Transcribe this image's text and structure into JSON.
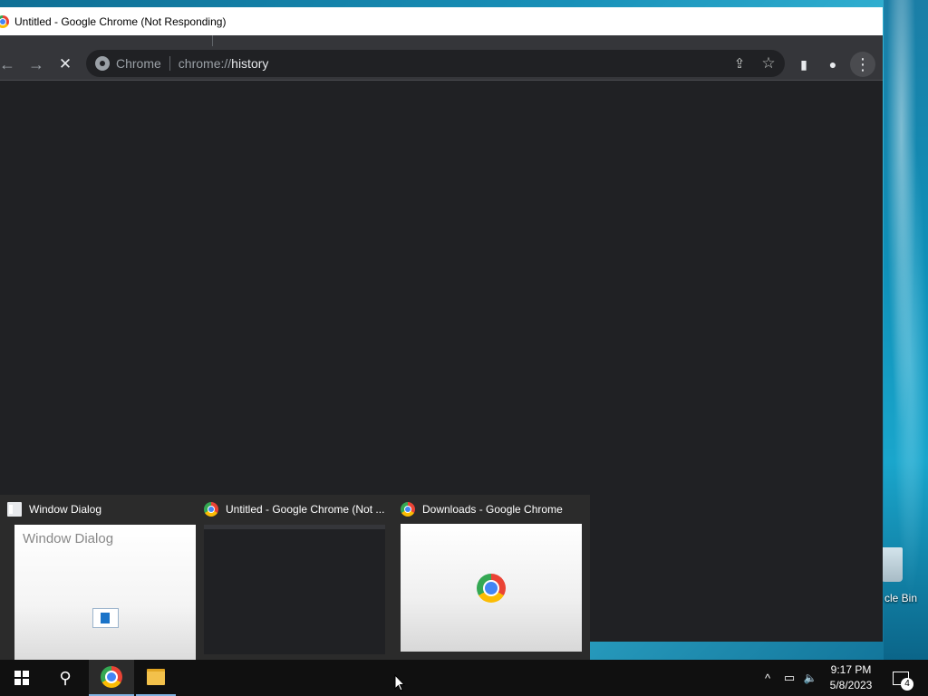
{
  "desktop": {
    "recycle_bin_label": "cle Bin"
  },
  "chrome": {
    "window_title": "Untitled - Google Chrome (Not Responding)",
    "omnibox": {
      "scheme_label": "Chrome",
      "url_prefix": "chrome://",
      "url_path": "history"
    },
    "icons": {
      "back": "←",
      "forward": "→",
      "stop": "✕",
      "share": "⇪",
      "bookmark": "☆",
      "side_panel": "▮",
      "profile": "●",
      "menu": "⋮"
    }
  },
  "thumbnails": [
    {
      "title": "Window Dialog",
      "preview_title": "Window Dialog"
    },
    {
      "title": "Untitled - Google Chrome (Not ..."
    },
    {
      "title": "Downloads - Google Chrome"
    }
  ],
  "taskbar": {
    "search_icon": "⚲",
    "tray": {
      "chevron": "^",
      "network": "▭",
      "volume": "🔈"
    },
    "clock": {
      "time": "9:17 PM",
      "date": "5/8/2023"
    },
    "notification_count": "4"
  }
}
